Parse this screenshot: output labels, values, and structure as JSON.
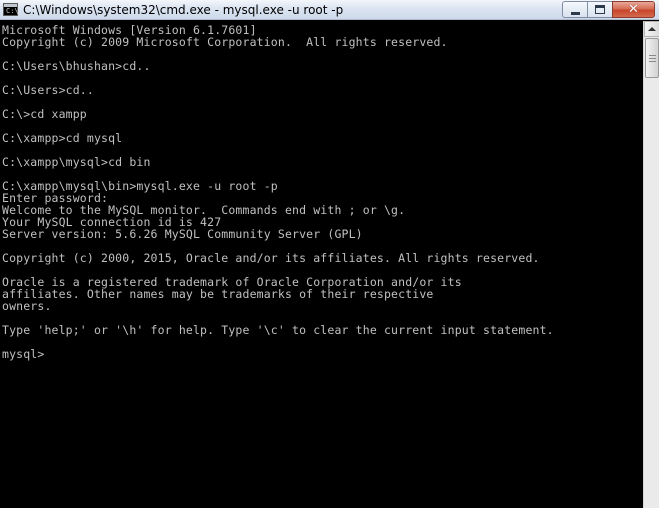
{
  "window": {
    "title": "C:\\Windows\\system32\\cmd.exe - mysql.exe  -u root -p",
    "icon": "cmd-icon",
    "icon_text": "C:\\"
  },
  "caption_buttons": {
    "minimize": "minimize-icon",
    "maximize": "maximize-icon",
    "close": "close-icon",
    "close_glyph": "✕"
  },
  "console": {
    "text_color": "#c0c0c0",
    "background": "#000000",
    "lines": [
      "Microsoft Windows [Version 6.1.7601]",
      "Copyright (c) 2009 Microsoft Corporation.  All rights reserved.",
      "",
      "C:\\Users\\bhushan>cd..",
      "",
      "C:\\Users>cd..",
      "",
      "C:\\>cd xampp",
      "",
      "C:\\xampp>cd mysql",
      "",
      "C:\\xampp\\mysql>cd bin",
      "",
      "C:\\xampp\\mysql\\bin>mysql.exe -u root -p",
      "Enter password:",
      "Welcome to the MySQL monitor.  Commands end with ; or \\g.",
      "Your MySQL connection id is 427",
      "Server version: 5.6.26 MySQL Community Server (GPL)",
      "",
      "Copyright (c) 2000, 2015, Oracle and/or its affiliates. All rights reserved.",
      "",
      "Oracle is a registered trademark of Oracle Corporation and/or its",
      "affiliates. Other names may be trademarks of their respective",
      "owners.",
      "",
      "Type 'help;' or '\\h' for help. Type '\\c' to clear the current input statement.",
      "",
      "mysql>"
    ]
  }
}
